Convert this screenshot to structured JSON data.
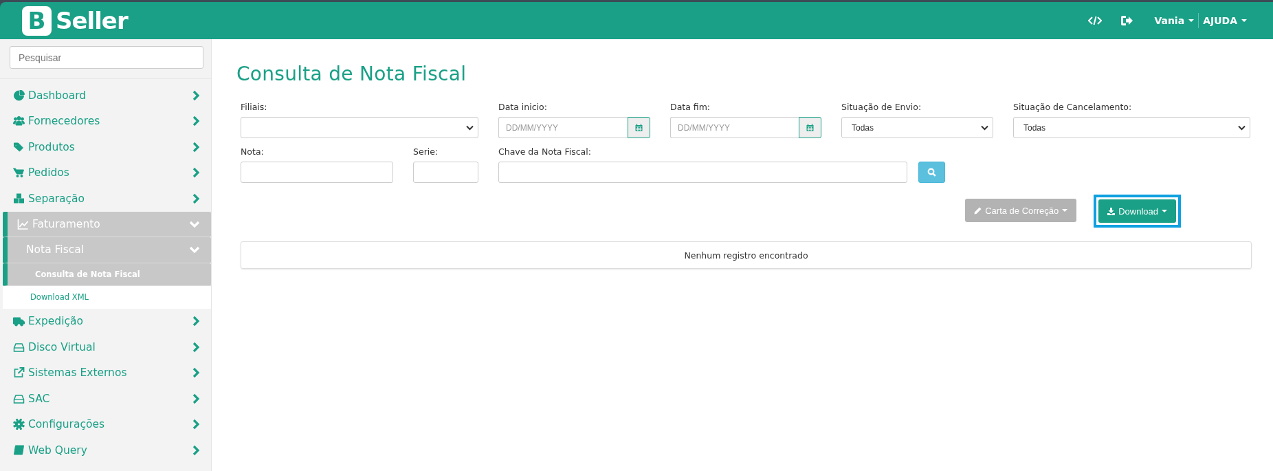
{
  "header": {
    "logo_letter": "B",
    "logo_text": "Seller",
    "user": "Vania",
    "help": "AJUDA"
  },
  "sidebar": {
    "search": {
      "placeholder": "Pesquisar"
    },
    "items": [
      {
        "label": "Dashboard",
        "selected": false,
        "expanded": false
      },
      {
        "label": "Fornecedores",
        "selected": false,
        "expanded": false
      },
      {
        "label": "Produtos",
        "selected": false,
        "expanded": false
      },
      {
        "label": "Pedidos",
        "selected": false,
        "expanded": false
      },
      {
        "label": "Separação",
        "selected": false,
        "expanded": false
      },
      {
        "label": "Faturamento",
        "selected": true,
        "expanded": true,
        "children": [
          {
            "label": "Nota Fiscal",
            "selected": true,
            "expanded": true,
            "children": [
              {
                "label": "Consulta de Nota Fiscal",
                "selected": true
              },
              {
                "label": "Download XML",
                "selected": false
              }
            ]
          }
        ]
      },
      {
        "label": "Expedição",
        "selected": false,
        "expanded": false
      },
      {
        "label": "Disco Virtual",
        "selected": false,
        "expanded": false
      },
      {
        "label": "Sistemas Externos",
        "selected": false,
        "expanded": false
      },
      {
        "label": "SAC",
        "selected": false,
        "expanded": false
      },
      {
        "label": "Configurações",
        "selected": false,
        "expanded": false
      },
      {
        "label": "Web Query",
        "selected": false,
        "expanded": false
      }
    ]
  },
  "page": {
    "title": "Consulta de Nota Fiscal"
  },
  "filter_rows": [
    [
      {
        "kind": "select",
        "label": "Filiais:"
      },
      {
        "kind": "date",
        "label": "Data inicio:",
        "placeholder": "DD/MM/YYYY"
      },
      {
        "kind": "date",
        "label": "Data fim:",
        "placeholder": "DD/MM/YYYY"
      },
      {
        "kind": "select",
        "label": "Situação de Envio:",
        "value": "Todas"
      },
      {
        "kind": "select",
        "label": "Situação de Cancelamento:",
        "value": "Todas"
      }
    ],
    [
      {
        "kind": "text",
        "label": "Nota:"
      },
      {
        "kind": "text",
        "label": "Serie:"
      },
      {
        "kind": "text",
        "label": "Chave da Nota Fiscal:"
      },
      {
        "kind": "search"
      }
    ]
  ],
  "actions": [
    {
      "kind": "edit",
      "label": "Carta de Correção",
      "disabled": true,
      "highlighted": false
    },
    {
      "kind": "download",
      "label": "Download",
      "disabled": false,
      "highlighted": true
    }
  ],
  "table": {
    "empty_message": "Nenhum registro encontrado"
  }
}
